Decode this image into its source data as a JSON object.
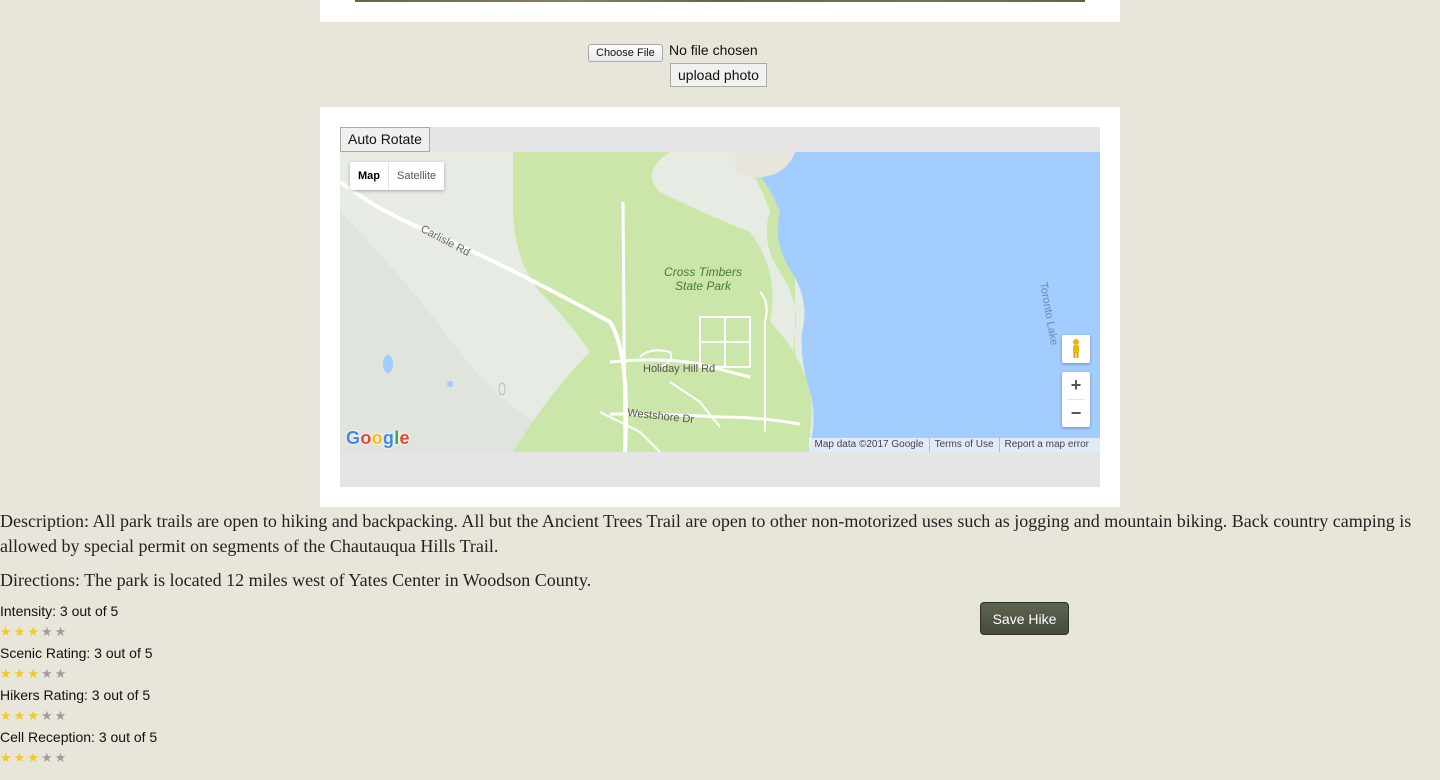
{
  "upload": {
    "choose_file_label": "Choose File",
    "no_file_text": "No file chosen",
    "upload_button_label": "upload photo"
  },
  "map": {
    "auto_rotate_label": "Auto Rotate",
    "map_type_map": "Map",
    "map_type_satellite": "Satellite",
    "labels": {
      "park_line1": "Cross Timbers",
      "park_line2": "State Park",
      "road_carlisle": "Carlisle Rd",
      "road_holiday_hill": "Holiday Hill Rd",
      "road_westshore": "Westshore Dr",
      "lake": "Toronto Lake"
    },
    "zoom_in": "+",
    "zoom_out": "−",
    "logo": "Google",
    "footer": {
      "attribution": "Map data ©2017 Google",
      "terms": "Terms of Use",
      "report": "Report a map error"
    },
    "colors": {
      "water": "#a3ccff",
      "park": "#cae6a8",
      "land": "#e8ece6"
    }
  },
  "details": {
    "description": "Description: All park trails are open to hiking and backpacking. All but the Ancient Trees Trail are open to other non-motorized uses such as jogging and mountain biking. Back country camping is allowed by special permit on segments of the Chautauqua Hills Trail.",
    "directions": "Directions: The park is located 12 miles west of Yates Center in Woodson County."
  },
  "ratings": [
    {
      "label": "Intensity: 3 out of 5",
      "value": 3,
      "max": 5
    },
    {
      "label": "Scenic Rating: 3 out of 5",
      "value": 3,
      "max": 5
    },
    {
      "label": "Hikers Rating: 3 out of 5",
      "value": 3,
      "max": 5
    },
    {
      "label": "Cell Reception: 3 out of 5",
      "value": 3,
      "max": 5
    }
  ],
  "save_button_label": "Save Hike"
}
